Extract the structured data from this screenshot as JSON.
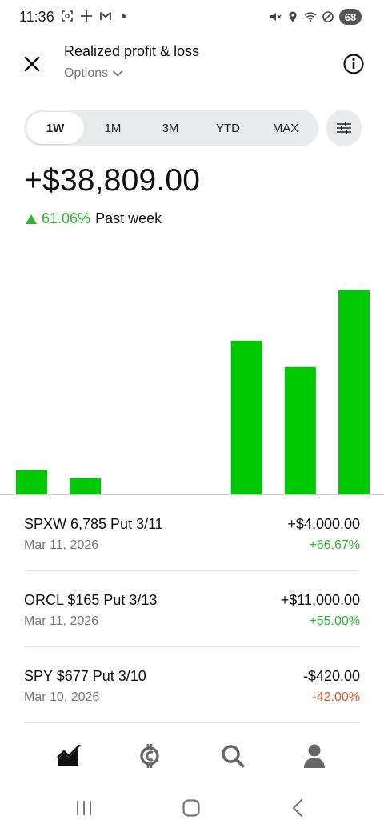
{
  "status_bar": {
    "time": "11:36",
    "battery": "68",
    "left_icons": [
      "screenshot-icon",
      "app-icon",
      "gmail-icon"
    ],
    "right_icons": [
      "mute-icon",
      "location-icon",
      "wifi-icon",
      "dnd-icon"
    ]
  },
  "header": {
    "title": "Realized profit & loss",
    "subtitle": "Options"
  },
  "periods": [
    {
      "label": "1W",
      "active": true
    },
    {
      "label": "1M",
      "active": false
    },
    {
      "label": "3M",
      "active": false
    },
    {
      "label": "YTD",
      "active": false
    },
    {
      "label": "MAX",
      "active": false
    }
  ],
  "summary": {
    "amount": "+$38,809.00",
    "change_pct": "61.06%",
    "change_period": "Past week"
  },
  "colors": {
    "positive": "#00c805",
    "positive_text": "#2bb52b",
    "negative_text": "#e0541f"
  },
  "chart_data": {
    "type": "bar",
    "categories": [
      "",
      "",
      "",
      "",
      "",
      "",
      ""
    ],
    "values": [
      1.2,
      0.8,
      0,
      0,
      7.6,
      6.3,
      10.1
    ],
    "xlabel": "",
    "ylabel": "",
    "ylim": [
      0,
      11
    ],
    "grid": false
  },
  "trades": [
    {
      "name": "SPXW 6,785 Put 3/11",
      "date": "Mar 11, 2026",
      "amount": "+$4,000.00",
      "pct": "+66.67%",
      "direction": "pos"
    },
    {
      "name": "ORCL $165 Put 3/13",
      "date": "Mar 11, 2026",
      "amount": "+$11,000.00",
      "pct": "+55.00%",
      "direction": "pos"
    },
    {
      "name": "SPY $677 Put 3/10",
      "date": "Mar 10, 2026",
      "amount": "-$420.00",
      "pct": "-42.00%",
      "direction": "neg"
    }
  ],
  "bottom_nav": [
    "investing-icon",
    "crypto-icon",
    "search-icon",
    "account-icon"
  ],
  "system_nav": [
    "recents-icon",
    "home-icon",
    "back-icon"
  ]
}
